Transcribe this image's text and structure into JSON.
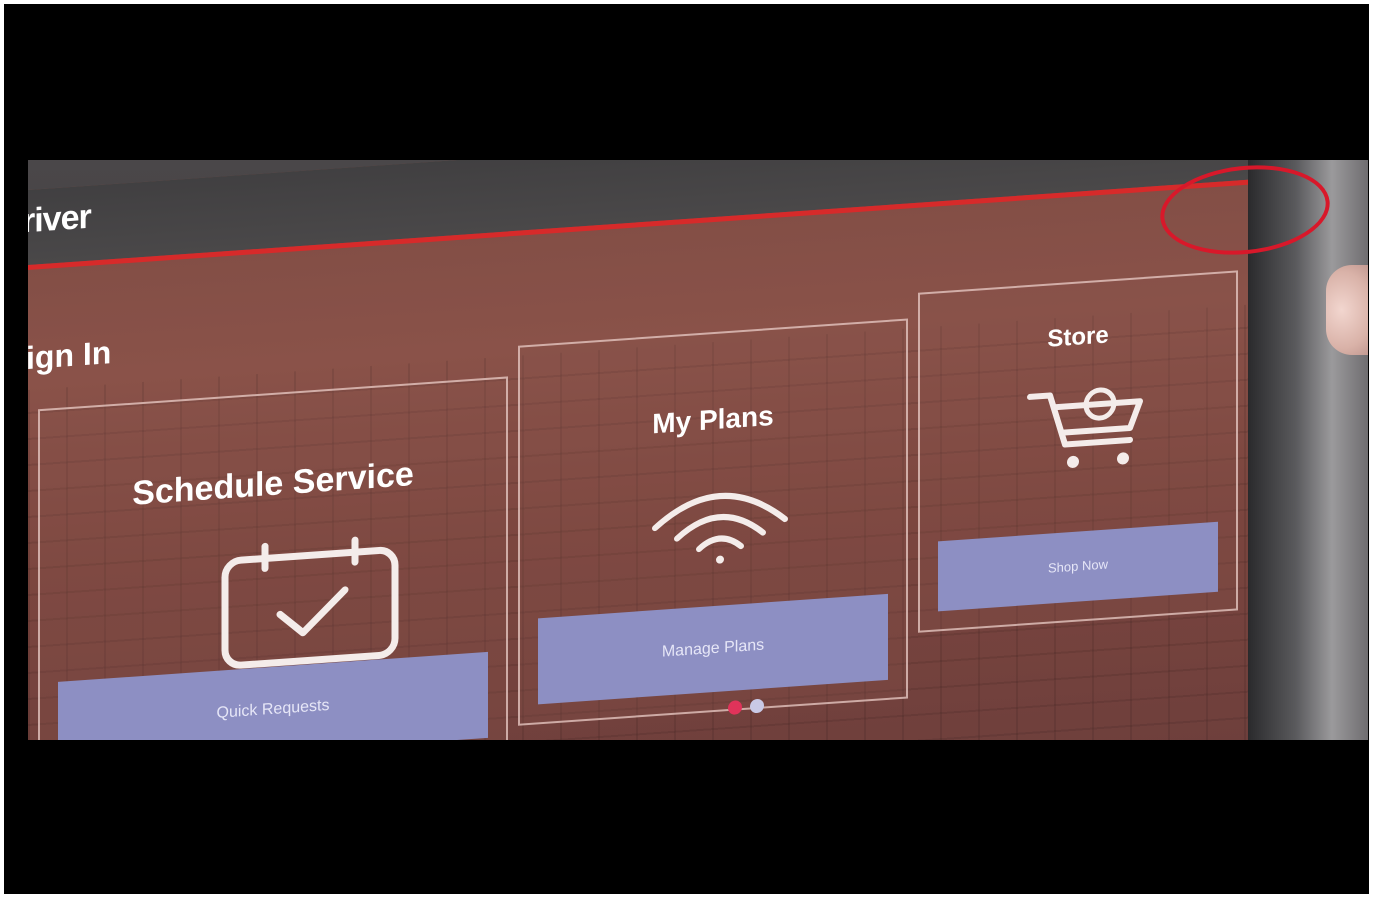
{
  "header": {
    "app_title": "river"
  },
  "section": {
    "title": "ign In"
  },
  "cards": [
    {
      "title": "Schedule Service",
      "icon": "calendar-check-icon",
      "action_label": "Quick Requests"
    },
    {
      "title": "My Plans",
      "icon": "wifi-signal-icon",
      "action_label": "Manage Plans"
    },
    {
      "title": "Store",
      "icon": "shopping-cart-icon",
      "action_label": "Shop Now"
    }
  ],
  "pager": {
    "active_color": "#e0335a",
    "inactive_color": "#c9c9e6"
  },
  "colors": {
    "accent": "#d72a2a",
    "annotation": "#d8182a",
    "action_button": "#8d8fc3"
  }
}
